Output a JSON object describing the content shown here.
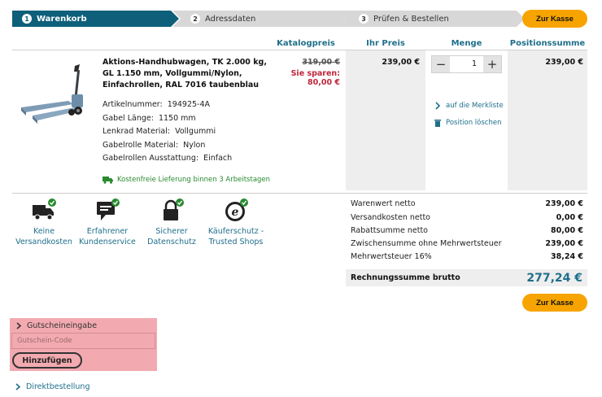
{
  "steps": [
    {
      "num": "1",
      "label": "Warenkorb"
    },
    {
      "num": "2",
      "label": "Adressdaten"
    },
    {
      "num": "3",
      "label": "Prüfen & Bestellen"
    }
  ],
  "checkout_label": "Zur Kasse",
  "columns": {
    "catalog_price": "Katalogpreis",
    "your_price": "Ihr Preis",
    "quantity": "Menge",
    "line_total": "Positionssumme"
  },
  "product": {
    "title": "Aktions-Handhubwagen, TK 2.000 kg, GL 1.150 mm, Vollgummi/Nylon, Einfachrollen, RAL 7016 taubenblau",
    "attributes": [
      {
        "label": "Artikelnummer:",
        "value": "194925-4A"
      },
      {
        "label": "Gabel Länge:",
        "value": "1150 mm"
      },
      {
        "label": "Lenkrad Material:",
        "value": "Vollgummi"
      },
      {
        "label": "Gabelrolle Material:",
        "value": "Nylon"
      },
      {
        "label": "Gabelrollen Ausstattung:",
        "value": "Einfach"
      }
    ],
    "shipping_note": "Kostenfreie Lieferung binnen 3 Arbeitstagen",
    "old_price": "319,00 €",
    "savings": "Sie sparen: 80,00 €",
    "your_price": "239,00 €",
    "quantity": "1",
    "line_total": "239,00 €",
    "wishlist_link": "auf die Merkliste",
    "delete_link": "Position löschen"
  },
  "badges": [
    {
      "icon": "truck-icon",
      "line1": "Keine",
      "line2": "Versandkosten"
    },
    {
      "icon": "chat-icon",
      "line1": "Erfahrener",
      "line2": "Kundenservice"
    },
    {
      "icon": "lock-icon",
      "line1": "Sicherer",
      "line2": "Datenschutz"
    },
    {
      "icon": "trusted-shops-icon",
      "line1": "Käuferschutz -",
      "line2": "Trusted Shops"
    }
  ],
  "totals": [
    {
      "label": "Warenwert netto",
      "value": "239,00 €"
    },
    {
      "label": "Versandkosten netto",
      "value": "0,00 €"
    },
    {
      "label": "Rabattsumme netto",
      "value": "80,00 €"
    },
    {
      "label": "Zwischensumme ohne Mehrwertsteuer",
      "value": "239,00 €"
    },
    {
      "label": "Mehrwertsteuer 16%",
      "value": "38,24 €"
    }
  ],
  "grand_total": {
    "label": "Rechnungssumme brutto",
    "value": "277,24 €"
  },
  "voucher": {
    "heading": "Gutscheineingabe",
    "placeholder": "Gutschein-Code",
    "button": "Hinzufügen"
  },
  "direct_order": "Direktbestellung",
  "colors": {
    "primary": "#0d5f7a",
    "link": "#1f6f8b",
    "accent": "#f7a400",
    "sale": "#c0263a",
    "success": "#2a8a30",
    "voucher_bg": "#f2aab0"
  }
}
